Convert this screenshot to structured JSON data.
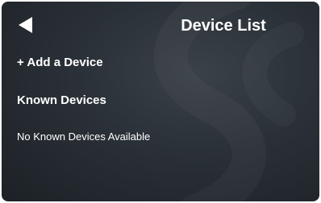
{
  "header": {
    "back_icon": "back-arrow-icon",
    "title": "Device List"
  },
  "actions": {
    "add_device_label": "+ Add a Device"
  },
  "known_devices": {
    "heading": "Known Devices",
    "empty_message": "No Known Devices Available",
    "items": []
  },
  "colors": {
    "background": "#2a3037",
    "text": "#ffffff"
  }
}
